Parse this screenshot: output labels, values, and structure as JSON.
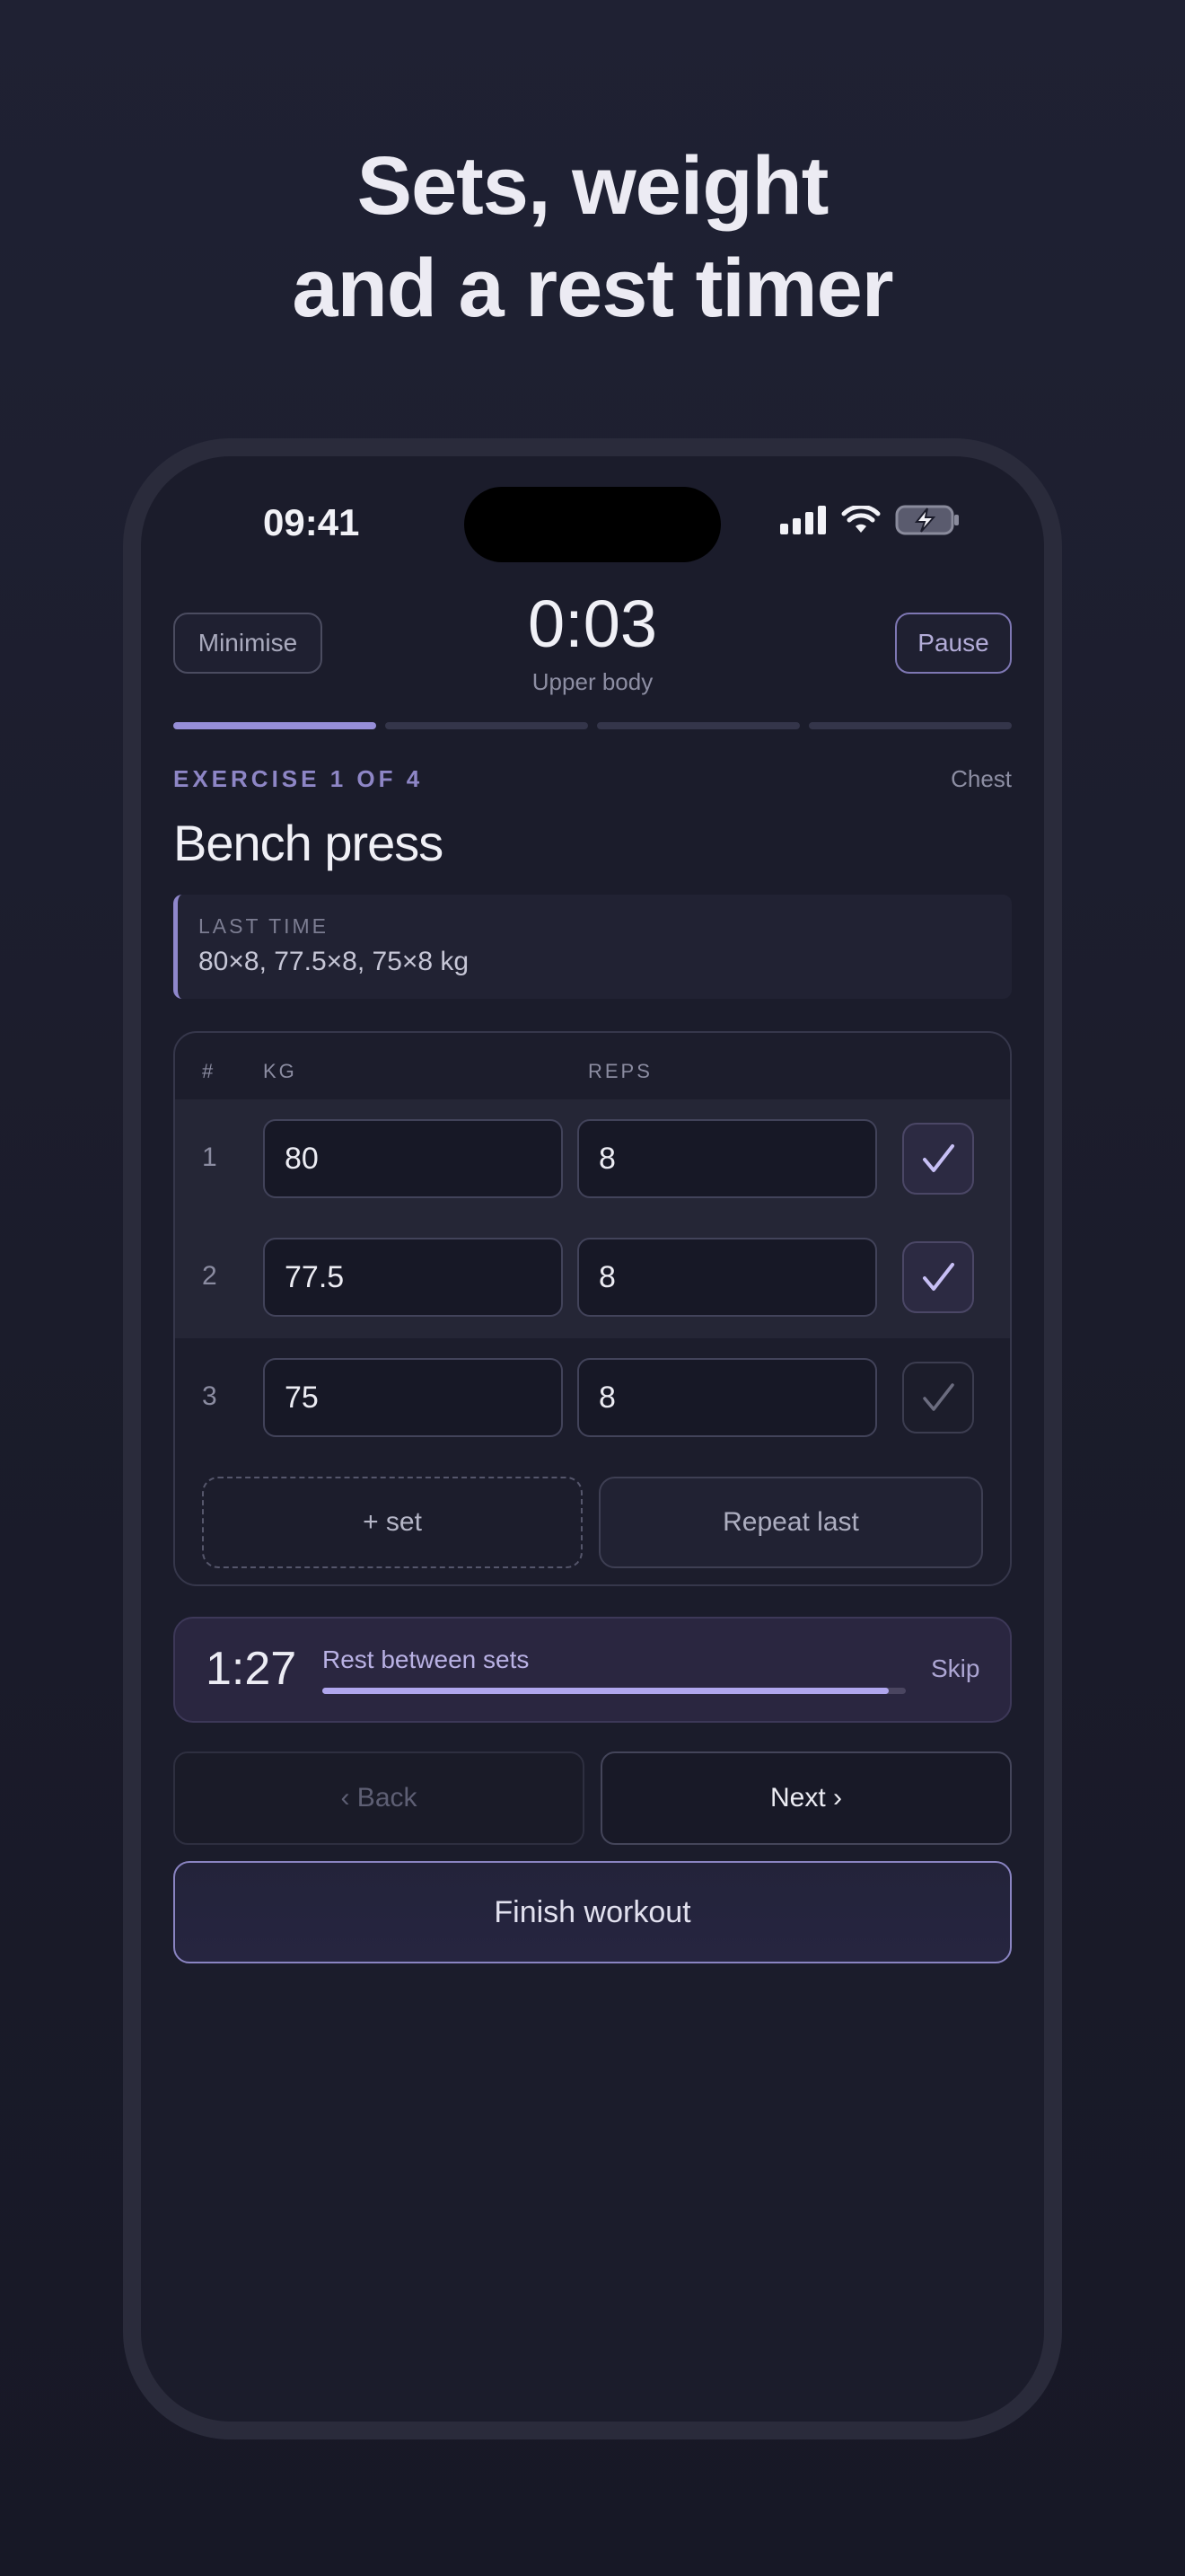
{
  "headline": {
    "line1": "Sets, weight",
    "line2": "and a rest timer"
  },
  "status_bar": {
    "time": "09:41",
    "icons": [
      "signal-icon",
      "wifi-icon",
      "battery-charging-icon"
    ]
  },
  "header": {
    "minimise_label": "Minimise",
    "timer": "0:03",
    "workout_name": "Upper body",
    "pause_label": "Pause"
  },
  "exercise_progress": {
    "total_segments": 4,
    "current": 1
  },
  "exercise": {
    "label": "EXERCISE 1 OF 4",
    "muscle_group": "Chest",
    "name": "Bench press",
    "last_time_label": "LAST TIME",
    "last_time_value": "80×8, 77.5×8, 75×8 kg"
  },
  "sets_table": {
    "columns": {
      "number": "#",
      "kg": "KG",
      "reps": "REPS"
    },
    "rows": [
      {
        "number": "1",
        "kg": "80",
        "reps": "8",
        "done": true
      },
      {
        "number": "2",
        "kg": "77.5",
        "reps": "8",
        "done": true
      },
      {
        "number": "3",
        "kg": "75",
        "reps": "8",
        "done": false
      }
    ],
    "add_set_label": "+ set",
    "repeat_last_label": "Repeat last"
  },
  "rest_timer": {
    "time": "1:27",
    "label": "Rest between sets",
    "progress_fraction": 0.97,
    "skip_label": "Skip"
  },
  "navigation": {
    "back_label": "‹ Back",
    "next_label": "Next ›",
    "finish_label": "Finish workout"
  },
  "colors": {
    "accent": "#8f87cc",
    "background": "#1b1c2b",
    "rest_fill": "#b0a6ee"
  }
}
